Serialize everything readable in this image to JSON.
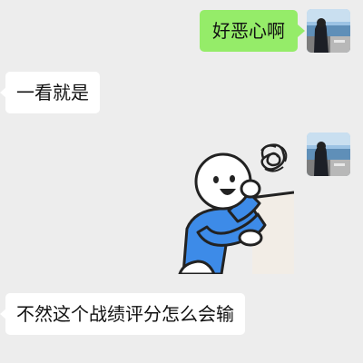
{
  "messages": [
    {
      "side": "out",
      "type": "text",
      "text": "好恶心啊"
    },
    {
      "side": "in",
      "type": "text",
      "text": "一看就是"
    },
    {
      "side": "out",
      "type": "sticker",
      "sticker": "cartoon-person-leaning-on-wall-with-scribble-sticker"
    },
    {
      "side": "in",
      "type": "text",
      "text": "不然这个战绩评分怎么会输"
    }
  ],
  "colors": {
    "background": "#ededed",
    "outgoing_bubble": "#95ec69",
    "incoming_bubble": "#ffffff",
    "sticker_shirt": "#3d8be8"
  },
  "icons": {
    "self_avatar": "avatar-photo-person-by-sea",
    "sticker_scribble": "scribble-face-icon"
  }
}
